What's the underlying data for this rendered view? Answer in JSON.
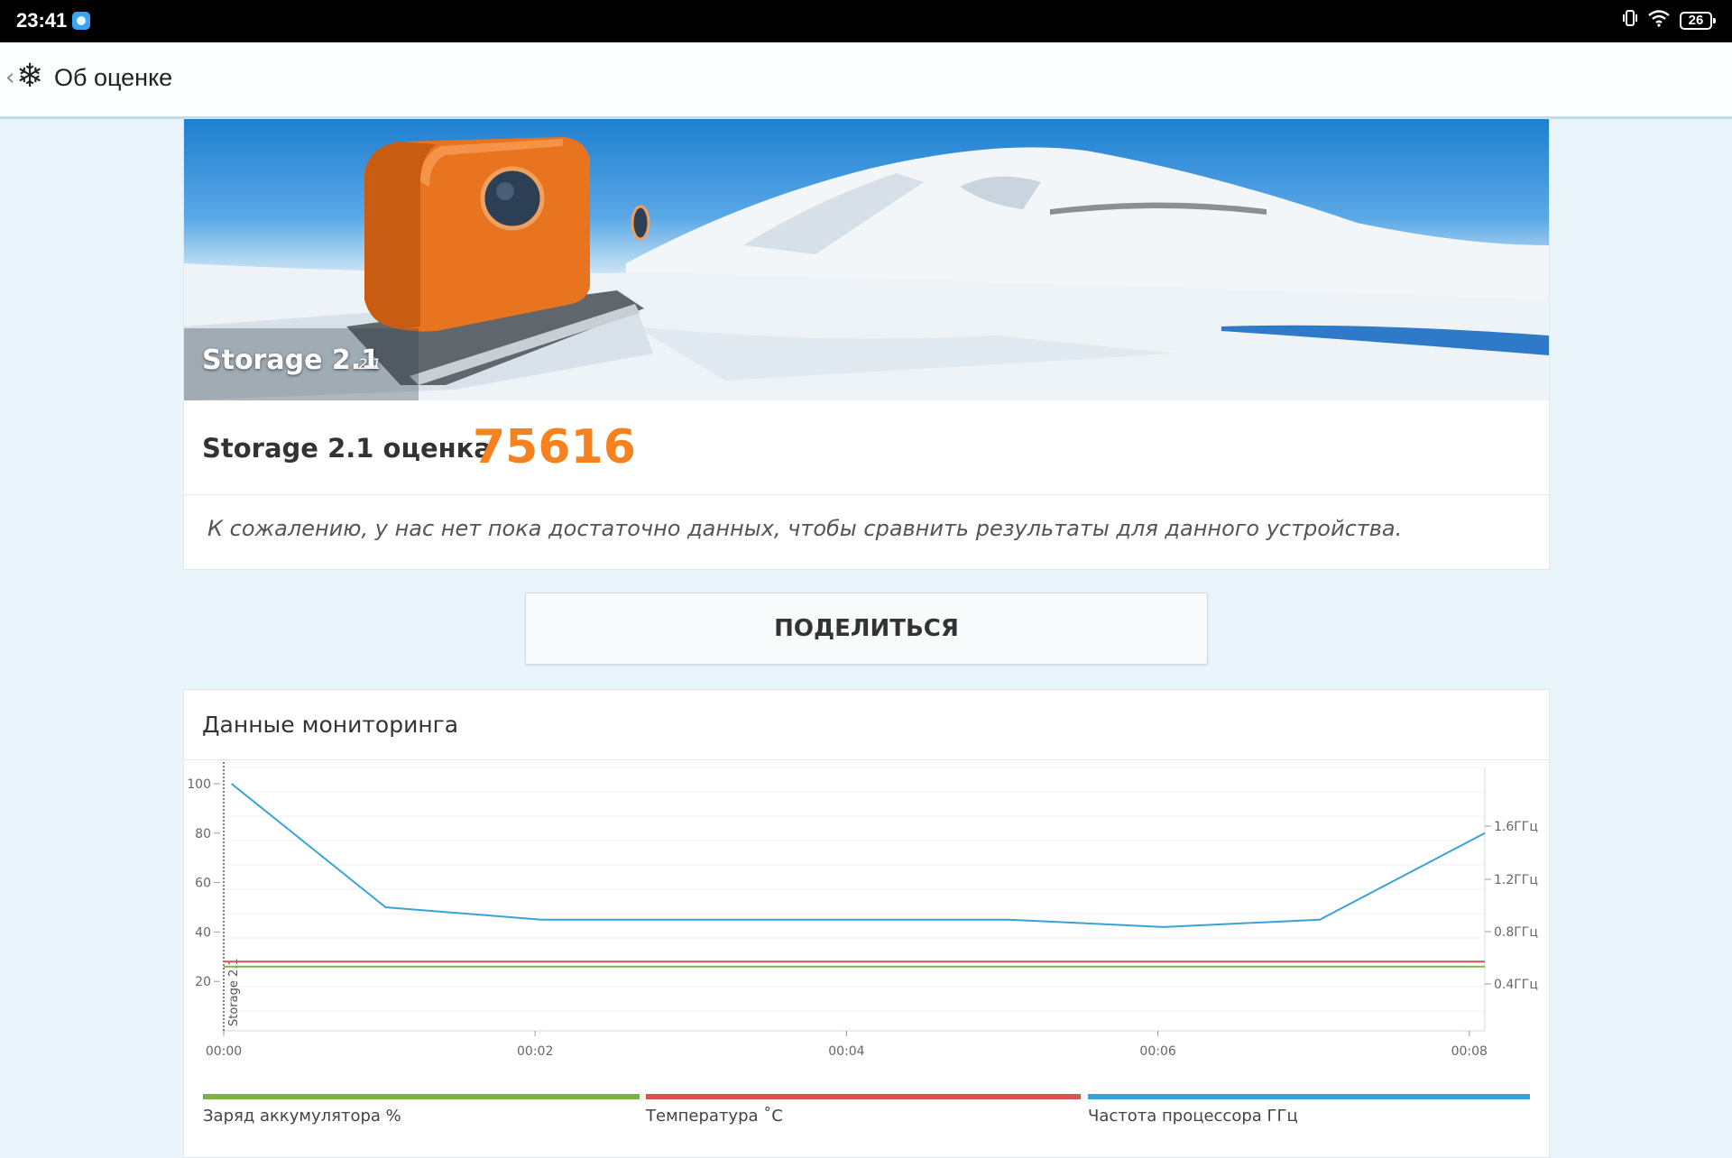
{
  "status_bar": {
    "time": "23:41",
    "battery": "26"
  },
  "app_bar": {
    "title": "Об оценке"
  },
  "result": {
    "benchmark_name": "Storage 2.1",
    "benchmark_version": "2.1",
    "score_label": "Storage 2.1 оценка",
    "score_value": "75616",
    "note": "К сожалению, у нас нет пока достаточно данных, чтобы сравнить результаты для данного устройства.",
    "share_label": "ПОДЕЛИТЬСЯ"
  },
  "monitoring": {
    "title": "Данные мониторинга",
    "legend": [
      {
        "label": "Заряд аккумулятора %",
        "color": "#7cb342"
      },
      {
        "label": "Температура ˚C",
        "color": "#d9534f"
      },
      {
        "label": "Частота процессора ГГц",
        "color": "#3aa2d9"
      }
    ]
  },
  "chart_data": {
    "type": "line",
    "x_ticks": [
      "00:00",
      "00:02",
      "00:04",
      "00:06",
      "00:08"
    ],
    "left_axis": {
      "ticks": [
        100,
        80,
        60,
        40,
        20
      ],
      "ylim": [
        0,
        100
      ]
    },
    "right_axis": {
      "ticks": [
        "1.6ГГц",
        "1.2ГГц",
        "0.8ГГц",
        "0.4ГГц"
      ],
      "values": [
        1.6,
        1.2,
        0.8,
        0.4
      ]
    },
    "marker_label": "Storage 2.1",
    "series": [
      {
        "name": "Заряд аккумулятора %",
        "color": "#7cb342",
        "x": [
          0,
          8.1
        ],
        "y": [
          26,
          26
        ]
      },
      {
        "name": "Температура ˚C",
        "color": "#d9534f",
        "x": [
          0,
          8.1
        ],
        "y": [
          28,
          28
        ]
      },
      {
        "name": "Частота процессора ГГц",
        "color": "#3aa2d9",
        "x": [
          0.05,
          1.04,
          2.04,
          3.04,
          4.04,
          5.04,
          6.04,
          7.04,
          8.1
        ],
        "y": [
          100,
          50,
          45,
          45,
          45,
          45,
          42,
          45,
          80
        ]
      }
    ]
  }
}
